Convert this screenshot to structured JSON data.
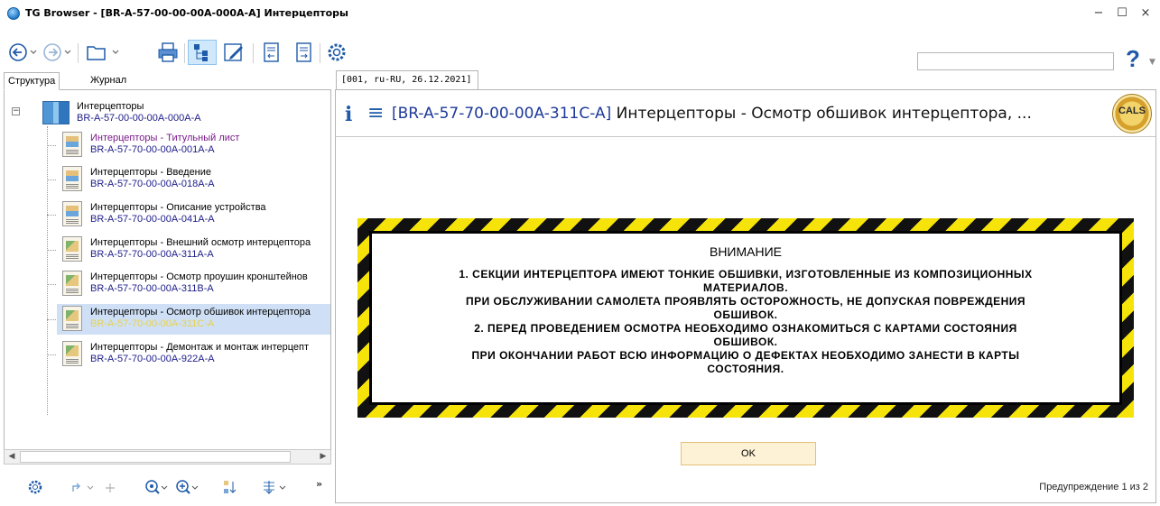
{
  "window": {
    "title": "TG Browser - [BR-A-57-00-00-00A-000A-A] Интерцепторы",
    "minimize": "−",
    "maximize": "☐",
    "close": "×"
  },
  "toolbar": {
    "icons": [
      "back-icon",
      "forward-icon",
      "open-folder-icon",
      "print-icon",
      "structure-icon",
      "edit-icon",
      "prev-doc-icon",
      "next-doc-icon",
      "settings-icon"
    ],
    "search_value": "",
    "help_label": "?"
  },
  "left_tabs": {
    "structure": "Структура",
    "journal": "Журнал"
  },
  "tree": {
    "root": {
      "title": "Интерцепторы",
      "code": "BR-A-57-00-00-00A-000A-A"
    },
    "items": [
      {
        "title": "Интерцепторы - Титульный лист",
        "code": "BR-A-57-70-00-00A-001A-A"
      },
      {
        "title": "Интерцепторы - Введение",
        "code": "BR-A-57-70-00-00A-018A-A"
      },
      {
        "title": "Интерцепторы - Описание устройства",
        "code": "BR-A-57-70-00-00A-041A-A"
      },
      {
        "title": "Интерцепторы - Внешний осмотр интерцептора",
        "code": "BR-A-57-70-00-00A-311A-A"
      },
      {
        "title": "Интерцепторы - Осмотр проушин кронштейнов",
        "code": "BR-A-57-70-00-00A-311B-A"
      },
      {
        "title": "Интерцепторы - Осмотр обшивок интерцептора",
        "code": "BR-A-57-70-00-00A-311C-A"
      },
      {
        "title": "Интерцепторы - Демонтаж и монтаж интерцепт",
        "code": "BR-A-57-70-00-00A-922A-A"
      }
    ]
  },
  "doc_tab": "[001, ru-RU, 26.12.2021]",
  "document": {
    "code": "[BR-A-57-70-00-00A-311C-A]",
    "title": " Интерцепторы - Осмотр обшивок интерцептора, ...",
    "logo_text": "CALS"
  },
  "warning": {
    "heading": "ВНИМАНИЕ",
    "lines": [
      "1. СЕКЦИИ ИНТЕРЦЕПТОРА ИМЕЮТ ТОНКИЕ ОБШИВКИ, ИЗГОТОВЛЕННЫЕ ИЗ КОМПОЗИЦИОННЫХ",
      "МАТЕРИАЛОВ.",
      "ПРИ ОБСЛУЖИВАНИИ САМОЛЕТА ПРОЯВЛЯТЬ ОСТОРОЖНОСТЬ, НЕ ДОПУСКАЯ ПОВРЕЖДЕНИЯ",
      "ОБШИВОК.",
      "2. ПЕРЕД ПРОВЕДЕНИЕМ ОСМОТРА НЕОБХОДИМО ОЗНАКОМИТЬСЯ С КАРТАМИ СОСТОЯНИЯ",
      "ОБШИВОК.",
      "ПРИ ОКОНЧАНИИ РАБОТ ВСЮ ИНФОРМАЦИЮ О ДЕФЕКТАХ НЕОБХОДИМО ЗАНЕСТИ В КАРТЫ",
      "СОСТОЯНИЯ."
    ],
    "ok_label": "OK",
    "counter": "Предупреждение 1 из 2"
  },
  "colors": {
    "accent_blue": "#1e5aa8",
    "selection": "#cfe0f6",
    "hazard_yellow": "#f5e30a",
    "ok_button_bg": "#fdf1d6"
  }
}
